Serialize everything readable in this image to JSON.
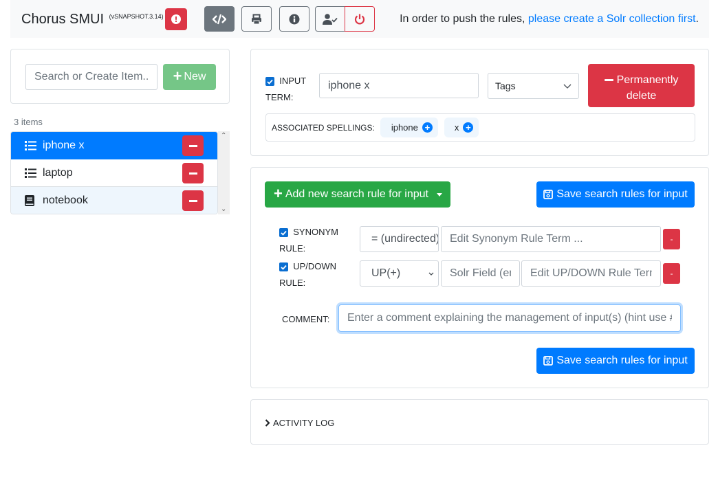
{
  "header": {
    "app_title": "Chorus SMUI",
    "version": "(vSNAPSHOT.3.14)",
    "alert_icon": "exclamation-circle-icon",
    "toolbar": [
      {
        "name": "code-button",
        "icon": "code-icon"
      },
      {
        "name": "print-button",
        "icon": "print-icon"
      },
      {
        "name": "info-button",
        "icon": "info-circle-icon"
      },
      {
        "name": "user-check-button",
        "icon": "user-check-icon"
      },
      {
        "name": "logout-button",
        "icon": "power-off-icon"
      }
    ],
    "push_message_prefix": "In order to push the rules, ",
    "push_message_link": "please create a Solr collection first",
    "push_message_suffix": "."
  },
  "sidebar": {
    "search_placeholder": "Search or Create Item...",
    "new_button": "New",
    "item_count": "3 items",
    "items": [
      {
        "label": "iphone x",
        "icon": "list-icon",
        "active": true
      },
      {
        "label": "laptop",
        "icon": "list-icon",
        "active": false
      },
      {
        "label": "notebook",
        "icon": "book-icon",
        "active": false
      }
    ]
  },
  "term_card": {
    "input_term_label_1": "INPUT",
    "input_term_label_2": "TERM:",
    "input_term_checked": true,
    "input_term_value": "iphone x",
    "tags_placeholder": "Tags",
    "permanently_delete": "Permanently delete",
    "associated_spellings_label": "ASSOCIATED SPELLINGS:",
    "spellings": [
      "iphone",
      "x"
    ]
  },
  "rules_card": {
    "add_rule_button": "Add new search rule for input",
    "save_button": "Save search rules for input",
    "rules": [
      {
        "type_label_1": "SYNONYM",
        "type_label_2": "RULE:",
        "checked": true,
        "select_value": "= (undirected)",
        "term_placeholder": "Edit Synonym Rule Term ...",
        "delete_label": "-"
      },
      {
        "type_label_1": "UP/DOWN",
        "type_label_2": "RULE:",
        "checked": true,
        "select_value": "UP(+)",
        "field_placeholder": "Solr Field (empty = all fields)",
        "term_placeholder": "Edit UP/DOWN Rule Term ...",
        "delete_label": "-"
      }
    ],
    "comment_label": "COMMENT:",
    "comment_placeholder": "Enter a comment explaining the management of input(s) (hint use #tags)"
  },
  "activity_log": {
    "label": "ACTIVITY LOG"
  },
  "colors": {
    "primary": "#007bff",
    "danger": "#dc3545",
    "success": "#28a745",
    "success_light": "#75c687",
    "secondary": "#6c757d"
  }
}
